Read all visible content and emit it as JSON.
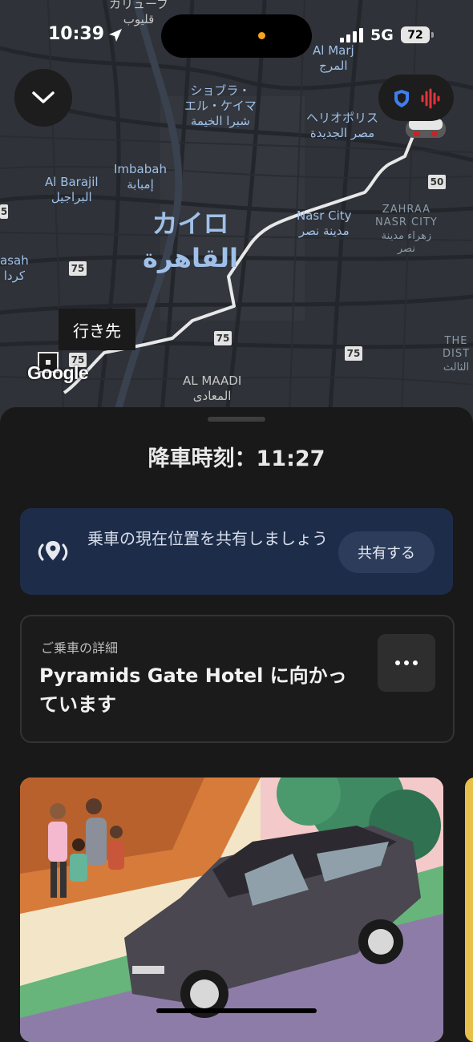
{
  "status_bar": {
    "time": "10:39",
    "network": "5G",
    "battery": "72",
    "location-arrow-icon": "location-arrow-icon"
  },
  "map": {
    "labels": {
      "qalyub": "カリューブ\nقليوب",
      "al_marj": "Al Marj\nالمرج",
      "shubra": "ショブラ・\nエル・ケイマ\nشبرا الخيمة",
      "heliopolis": "ヘリオポリス\nمصر الجديدة",
      "al_barajil": "Al Barajil\nالبراجيل",
      "imbabah": "Imbabah\nإمبابة",
      "cairo": "カイロ\nالقاهرة",
      "nasr_city": "Nasr City\nمدينة نصر",
      "zahraa": "ZAHRAA\nNASR CITY\nزهراء مدينة\nنصر",
      "nasah": "asah\nكردا",
      "al_maadi": "AL MAADI\nالمعادى",
      "the_dist": "THE\nDIST\nالثالث"
    },
    "shields": [
      "75",
      "75",
      "75",
      "75",
      "50",
      "5"
    ],
    "destination_tag": "行き先",
    "attribution": "Google"
  },
  "controls": {
    "collapse_icon": "chevron-down-icon",
    "safety_icons": [
      "shield-icon",
      "voice-wave-icon"
    ]
  },
  "sheet": {
    "dropoff": "降車時刻：11:27",
    "share_card": {
      "text": "乗車の現在位置を共有しましょう",
      "button": "共有する",
      "icon": "live-location-icon"
    },
    "ride_details": {
      "label": "ご乗車の詳細",
      "title": "Pyramids Gate Hotel に向かっています",
      "more_icon": "more-options-icon"
    },
    "promo_icon": "family-car-illustration"
  },
  "colors": {
    "map_bg": "#2f3238",
    "route": "#e8e8e8",
    "share_card_bg": "#1d2d49",
    "label_blue": "#9fc0e8",
    "sheet_bg": "#191919"
  }
}
